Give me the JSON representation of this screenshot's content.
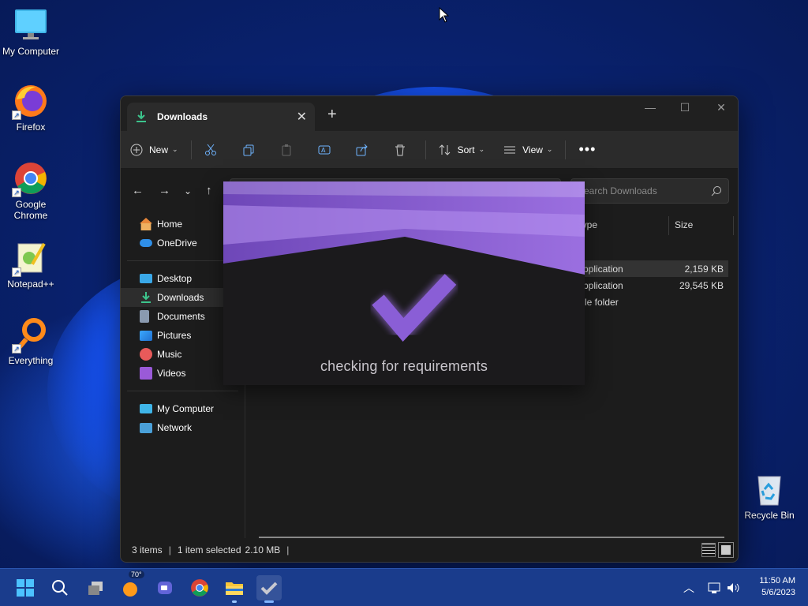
{
  "desktop": {
    "icons": [
      {
        "label": "My Computer",
        "icon": "monitor-icon"
      },
      {
        "label": "Firefox",
        "icon": "firefox-icon"
      },
      {
        "label": "Google Chrome",
        "icon": "chrome-icon"
      },
      {
        "label": "Notepad++",
        "icon": "notepadpp-icon"
      },
      {
        "label": "Everything",
        "icon": "everything-icon"
      },
      {
        "label": "Recycle Bin",
        "icon": "recycle-bin-icon"
      }
    ]
  },
  "window": {
    "tab_title": "Downloads",
    "toolbar": {
      "new_label": "New",
      "sort_label": "Sort",
      "view_label": "View"
    },
    "search_placeholder": "Search Downloads",
    "sidebar": {
      "group1": [
        "Home",
        "OneDrive"
      ],
      "group2": [
        "Desktop",
        "Downloads",
        "Documents",
        "Pictures",
        "Music",
        "Videos"
      ],
      "group3": [
        "My Computer",
        "Network"
      ],
      "selected": "Downloads"
    },
    "columns": {
      "type": "Type",
      "size": "Size"
    },
    "rows": [
      {
        "type": "Application",
        "size": "2,159 KB",
        "selected": true
      },
      {
        "type": "Application",
        "size": "29,545 KB",
        "selected": false
      },
      {
        "type": "File folder",
        "size": "",
        "selected": false
      }
    ],
    "status": {
      "items": "3 items",
      "selection": "1 item selected",
      "size": "2.10 MB"
    }
  },
  "overlay": {
    "message": "checking for requirements",
    "accent": "#9b6fe0"
  },
  "taskbar": {
    "weather_temp": "70°",
    "time": "11:50 AM",
    "date": "5/6/2023"
  }
}
